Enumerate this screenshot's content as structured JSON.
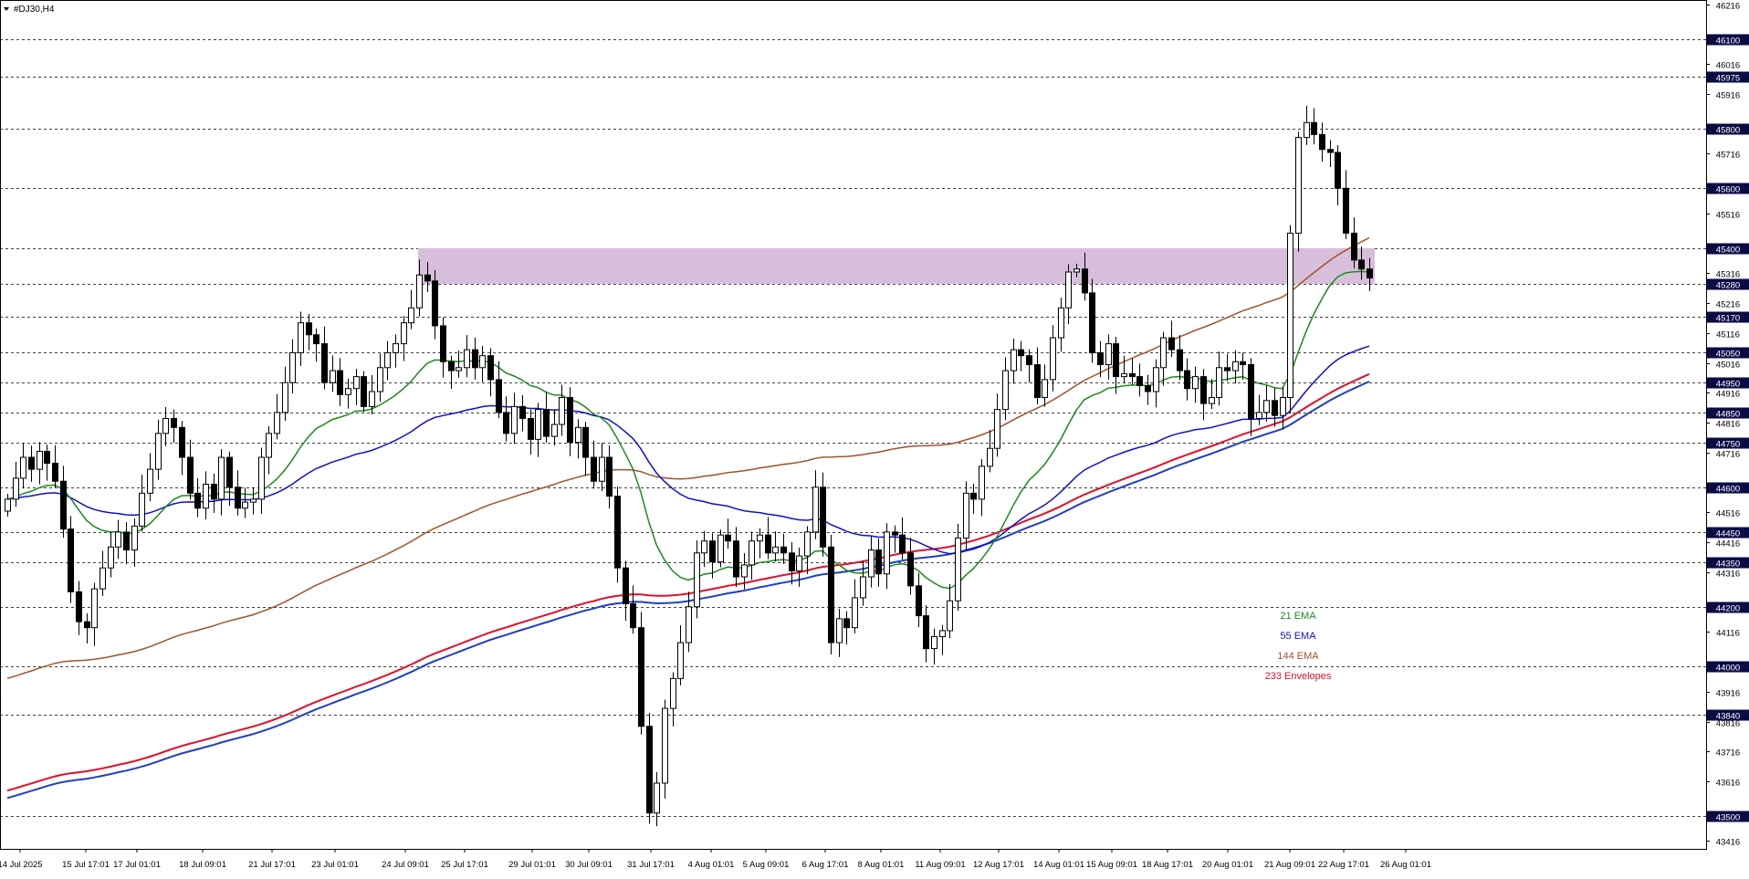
{
  "window": {
    "title": "#DJ30,H4",
    "menu_icon": "triangle-down-icon"
  },
  "colors": {
    "background": "#ffffff",
    "grid": "#000000",
    "candle": "#000000",
    "ema21": "#1a8a1a",
    "ema55": "#1010cc",
    "ema144": "#a0522d",
    "env_upper": "#e0102a",
    "env_lower": "#1f3fbf",
    "zone": "#d7bfdc",
    "price_box": "#0a0a44",
    "price_box_text": "#ffffff"
  },
  "legend": [
    {
      "text": "21 EMA",
      "color": "#1a8a1a"
    },
    {
      "text": "55 EMA",
      "color": "#1010cc"
    },
    {
      "text": "144 EMA",
      "color": "#a0522d"
    },
    {
      "text": "233 Envelopes",
      "color": "#e0102a"
    }
  ],
  "chart_data": {
    "type": "candlestick",
    "symbol": "#DJ30",
    "timeframe": "H4",
    "ylim": [
      43390,
      46230
    ],
    "y_ticks": [
      "46216",
      "46016",
      "45916",
      "45716",
      "45516",
      "45316",
      "45216",
      "45116",
      "45016",
      "44916",
      "44816",
      "44716",
      "44516",
      "44416",
      "44316",
      "44116",
      "43916",
      "43816",
      "43716",
      "43616",
      "43416"
    ],
    "price_levels": [
      "46100",
      "45975",
      "45800",
      "45600",
      "45400",
      "45280",
      "45170",
      "45050",
      "44950",
      "44850",
      "44750",
      "44600",
      "44450",
      "44350",
      "44200",
      "44000",
      "43840",
      "43500"
    ],
    "x_labels": [
      "14 Jul 2025",
      "15 Jul 17:01",
      "17 Jul 01:01",
      "18 Jul 09:01",
      "21 Jul 17:01",
      "23 Jul 01:01",
      "24 Jul 09:01",
      "25 Jul 17:01",
      "29 Jul 01:01",
      "30 Jul 09:01",
      "31 Jul 17:01",
      "4 Aug 01:01",
      "5 Aug 09:01",
      "6 Aug 17:01",
      "8 Aug 01:01",
      "11 Aug 09:01",
      "12 Aug 17:01",
      "14 Aug 01:01",
      "15 Aug 09:01",
      "18 Aug 17:01",
      "20 Aug 01:01",
      "21 Aug 09:01",
      "22 Aug 17:01",
      "26 Aug 01:01"
    ],
    "resistance_zone": [
      45280,
      45400
    ],
    "series_names": [
      "21 EMA",
      "55 EMA",
      "144 EMA",
      "233 Envelopes"
    ],
    "close": [
      44560,
      44630,
      44700,
      44660,
      44720,
      44680,
      44620,
      44460,
      44250,
      44150,
      44130,
      44260,
      44330,
      44400,
      44450,
      44390,
      44470,
      44580,
      44660,
      44780,
      44830,
      44800,
      44700,
      44580,
      44530,
      44610,
      44560,
      44700,
      44600,
      44530,
      44550,
      44560,
      44700,
      44780,
      44850,
      44950,
      45050,
      45150,
      45110,
      45080,
      44950,
      44990,
      44910,
      44930,
      44970,
      44870,
      44920,
      45000,
      45050,
      45080,
      45150,
      45200,
      45310,
      45290,
      45140,
      45020,
      44990,
      45000,
      45060,
      45000,
      45040,
      44960,
      44850,
      44780,
      44870,
      44830,
      44760,
      44860,
      44770,
      44810,
      44900,
      44750,
      44800,
      44700,
      44620,
      44700,
      44570,
      44330,
      44210,
      44130,
      43800,
      43510,
      43610,
      43860,
      43960,
      44080,
      44200,
      44380,
      44420,
      44350,
      44440,
      44420,
      44300,
      44340,
      44420,
      44440,
      44380,
      44400,
      44380,
      44320,
      44370,
      44450,
      44600,
      44400,
      44080,
      44160,
      44130,
      44230,
      44300,
      44390,
      44310,
      44450,
      44440,
      44380,
      44270,
      44170,
      44060,
      44100,
      44120,
      44220,
      44430,
      44580,
      44560,
      44670,
      44730,
      44860,
      44990,
      45060,
      45040,
      45010,
      44900,
      44960,
      45100,
      45200,
      45320,
      45330,
      45250,
      45050,
      45010,
      45080,
      44970,
      44980,
      44970,
      44940,
      44920,
      45000,
      45100,
      45060,
      44990,
      44930,
      44970,
      44880,
      44900,
      45000,
      44990,
      45020,
      45010,
      44830,
      44850,
      44890,
      44840,
      44900,
      45450,
      45770,
      45820,
      45780,
      45730,
      45720,
      45600,
      45450,
      45360,
      45330,
      45300
    ]
  }
}
